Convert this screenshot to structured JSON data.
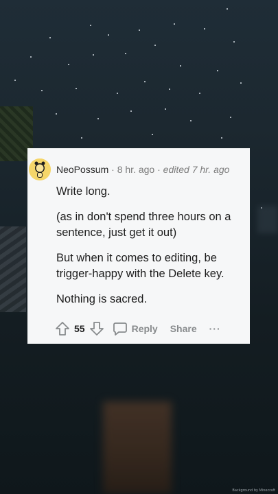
{
  "comment": {
    "username": "NeoPossum",
    "separator1": "·",
    "time": "8 hr. ago",
    "separator2": "·",
    "edited": "edited 7 hr. ago",
    "paragraphs": [
      "Write long.",
      "(as in don't spend three hours on a sentence, just get it out)",
      "But when it comes to editing, be trigger-happy with the Delete key.",
      "Nothing is sacred."
    ],
    "score": "55",
    "reply_label": "Reply",
    "share_label": "Share",
    "more_label": "···"
  },
  "background": {
    "watermark": "Background by Minecraft"
  },
  "colors": {
    "card_bg": "#f6f7f8",
    "avatar": "#f5d66a",
    "text": "#1c1c1c",
    "muted": "#878a8c"
  }
}
